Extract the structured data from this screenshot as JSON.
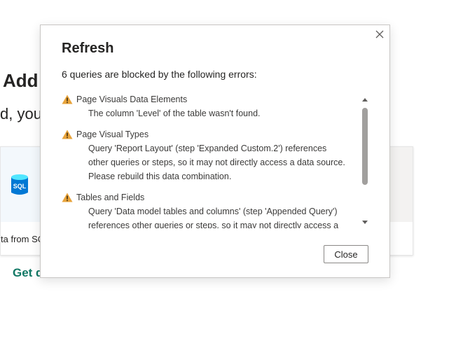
{
  "background": {
    "title": "Add",
    "subtitle": "d, you",
    "card_label": "ta from SQ",
    "sql_icon_text": "SQL",
    "link": "Get d"
  },
  "dialog": {
    "title": "Refresh",
    "summary": "6 queries are blocked by the following errors:",
    "errors": [
      {
        "name": "Page Visuals Data Elements",
        "lines": [
          "The column 'Level' of the table wasn't found."
        ]
      },
      {
        "name": "Page Visual Types",
        "lines": [
          "Query 'Report Layout' (step 'Expanded Custom.2') references",
          "other queries or steps, so it may not directly access a data source.",
          "Please rebuild this data combination."
        ]
      },
      {
        "name": "Tables and Fields",
        "lines": [
          "Query 'Data model tables and columns' (step 'Appended Query')",
          "references other queries or steps, so it may not directly access a"
        ]
      }
    ],
    "close_button": "Close"
  },
  "colors": {
    "accent_link": "#117865",
    "warning": "#e8a33a",
    "sql_icon": "#0078d4"
  }
}
